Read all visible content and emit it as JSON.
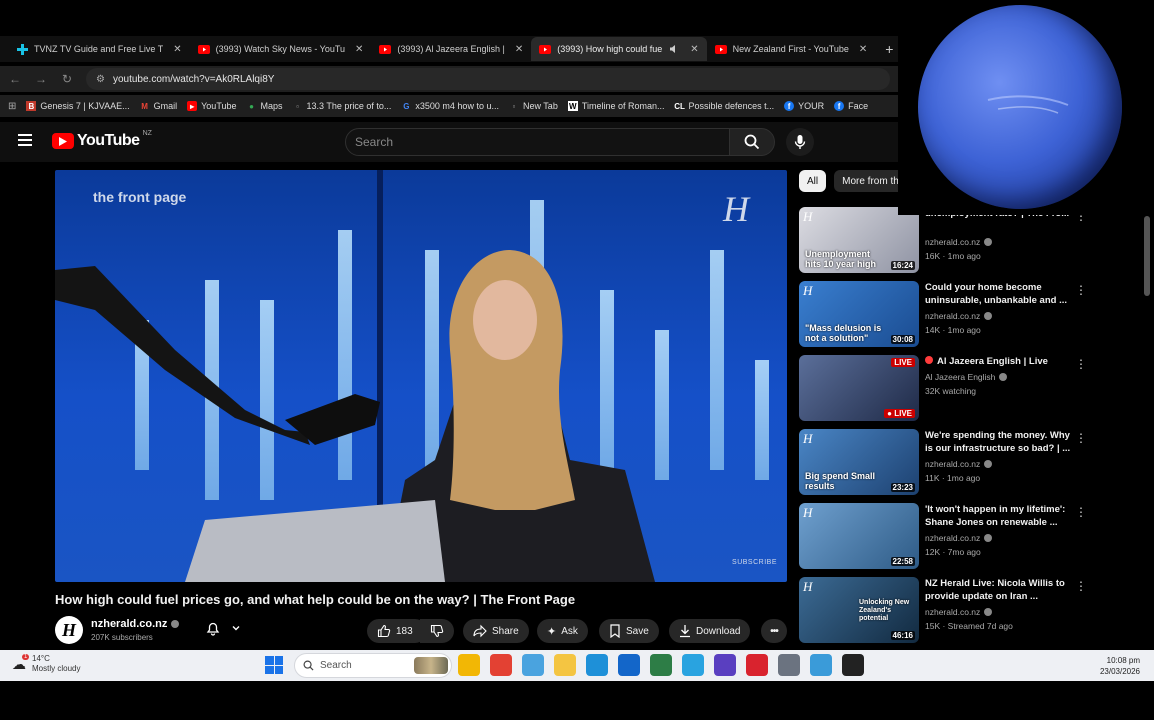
{
  "browser": {
    "tabs": [
      {
        "title": "TVNZ TV Guide and Free Live T",
        "icon": "tvnz-icon",
        "active": false
      },
      {
        "title": "(3993) Watch Sky News - YouTu",
        "icon": "youtube-icon",
        "active": false
      },
      {
        "title": "(3993) Al Jazeera English |",
        "icon": "youtube-icon",
        "active": false
      },
      {
        "title": "(3993) How high could fue",
        "icon": "youtube-icon",
        "active": true
      },
      {
        "title": "New Zealand First - YouTube",
        "icon": "youtube-icon",
        "active": false
      }
    ],
    "url": "youtube.com/watch?v=Ak0RLAlqi8Y",
    "bookmarks": [
      {
        "label": "Genesis 7 | KJVAAE...",
        "icon": "bible-icon"
      },
      {
        "label": "Gmail",
        "icon": "gmail-icon"
      },
      {
        "label": "YouTube",
        "icon": "youtube-icon"
      },
      {
        "label": "Maps",
        "icon": "maps-icon"
      },
      {
        "label": "13.3 The price of to...",
        "icon": "page-icon"
      },
      {
        "label": "x3500 m4 how to u...",
        "icon": "google-icon"
      },
      {
        "label": "New Tab",
        "icon": "page-icon"
      },
      {
        "label": "Timeline of Roman...",
        "icon": "wikipedia-icon"
      },
      {
        "label": "Possible defences t...",
        "icon": "cl-icon"
      },
      {
        "label": "YOUR",
        "icon": "facebook-icon"
      },
      {
        "label": "Face",
        "icon": "facebook-icon"
      }
    ]
  },
  "youtube": {
    "region": "NZ",
    "search_placeholder": "Search",
    "video": {
      "overlay_brand": "the front page",
      "overlay_corner": "H",
      "watermark": "SUBSCRIBE"
    },
    "title": "How high could fuel prices go, and what help could be on the way? | The Front Page",
    "channel": {
      "name": "nzherald.co.nz",
      "subscribers": "207K subscribers",
      "avatar_letter": "H"
    },
    "actions": {
      "likes": "183",
      "share": "Share",
      "ask": "Ask",
      "save": "Save",
      "download": "Download"
    },
    "chips": [
      "All",
      "More from th"
    ],
    "recommendations": [
      {
        "title": "unemployment rate? | The Fro...",
        "channel": "nzherald.co.nz",
        "meta": "16K · 1mo ago",
        "duration": "16:24",
        "caption": "Unemployment hits 10 year high",
        "thumb_color": "#c9c9cf",
        "live": false,
        "verified": true
      },
      {
        "title": "Could your home become uninsurable, unbankable and ...",
        "channel": "nzherald.co.nz",
        "meta": "14K · 1mo ago",
        "duration": "30:08",
        "caption": "\"Mass delusion is not a solution\"",
        "thumb_color": "#2e6fc2",
        "live": false,
        "verified": true
      },
      {
        "title": "Al Jazeera English | Live",
        "channel": "Al Jazeera English",
        "meta": "32K watching",
        "duration": "LIVE",
        "caption": "",
        "thumb_color": "#3c4c78",
        "live": true,
        "verified": true
      },
      {
        "title": "We're spending the money. Why is our infrastructure so bad? | ...",
        "channel": "nzherald.co.nz",
        "meta": "11K · 1mo ago",
        "duration": "23:23",
        "caption": "Big spend Small results",
        "thumb_color": "#3f78b8",
        "live": false,
        "verified": true
      },
      {
        "title": "'It won't happen in my lifetime': Shane Jones on renewable ...",
        "channel": "nzherald.co.nz",
        "meta": "12K · 7mo ago",
        "duration": "22:58",
        "caption": "",
        "thumb_color": "#4a7aa8",
        "live": false,
        "verified": true
      },
      {
        "title": "NZ Herald Live: Nicola Willis to provide update on Iran ...",
        "channel": "nzherald.co.nz",
        "meta": "15K · Streamed 7d ago",
        "duration": "46:16",
        "caption": "Unlocking New Zealand's potential",
        "thumb_color": "#2a4d6e",
        "live": false,
        "verified": true
      }
    ]
  },
  "taskbar": {
    "weather_temp": "14°C",
    "weather_desc": "Mostly cloudy",
    "weather_badge": "1",
    "search_placeholder": "Search",
    "time": "10:08 pm",
    "date": "23/03/2026",
    "apps": [
      {
        "name": "file-explorer-icon",
        "color": "#f2b705"
      },
      {
        "name": "chrome-icon",
        "color": "#e34133"
      },
      {
        "name": "copilot-icon",
        "color": "#4aa3df"
      },
      {
        "name": "folder-icon",
        "color": "#f4c542"
      },
      {
        "name": "edge-icon",
        "color": "#1e90d8"
      },
      {
        "name": "outlook-icon",
        "color": "#1366c9"
      },
      {
        "name": "xbox-icon",
        "color": "#2d7d46"
      },
      {
        "name": "telegram-icon",
        "color": "#29a3e0"
      },
      {
        "name": "app-icon",
        "color": "#5a3fc0"
      },
      {
        "name": "acrobat-icon",
        "color": "#d9232e"
      },
      {
        "name": "game-controller-icon",
        "color": "#6b7380"
      },
      {
        "name": "network-icon",
        "color": "#3a9bd9"
      },
      {
        "name": "obs-icon",
        "color": "#222222"
      }
    ]
  },
  "colors": {
    "youtube_red": "#ff0000",
    "background": "#0f0f0f",
    "neptune": "#3e63d6"
  }
}
